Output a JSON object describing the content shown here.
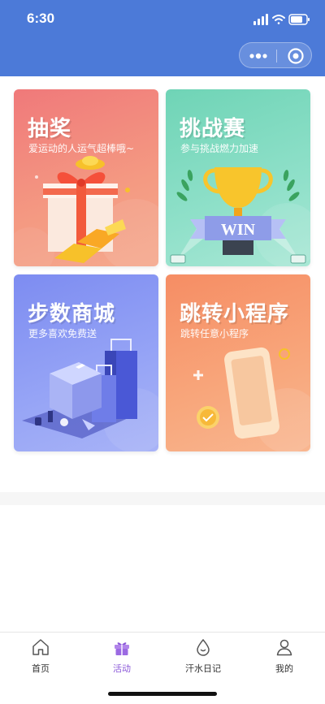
{
  "status_bar": {
    "time": "6:30"
  },
  "cards": [
    {
      "title": "抽奖",
      "subtitle": "爱运动的人运气超棒哦~"
    },
    {
      "title": "挑战赛",
      "subtitle": "参与挑战燃力加速",
      "badge": "WIN"
    },
    {
      "title": "步数商城",
      "subtitle": "更多喜欢免费送"
    },
    {
      "title": "跳转小程序",
      "subtitle": "跳转任意小程序"
    }
  ],
  "tabbar": {
    "items": [
      {
        "label": "首页",
        "icon": "home-icon"
      },
      {
        "label": "活动",
        "icon": "gift-icon",
        "active": true
      },
      {
        "label": "汗水日记",
        "icon": "sweat-drop-icon"
      },
      {
        "label": "我的",
        "icon": "user-icon"
      }
    ]
  },
  "colors": {
    "header": "#4c7ad8",
    "active_tab": "#8b58d8",
    "card_lottery": "#f0797a",
    "card_challenge": "#6fd4b6",
    "card_mall": "#7d8cf1",
    "card_miniprogram": "#f68d64"
  }
}
